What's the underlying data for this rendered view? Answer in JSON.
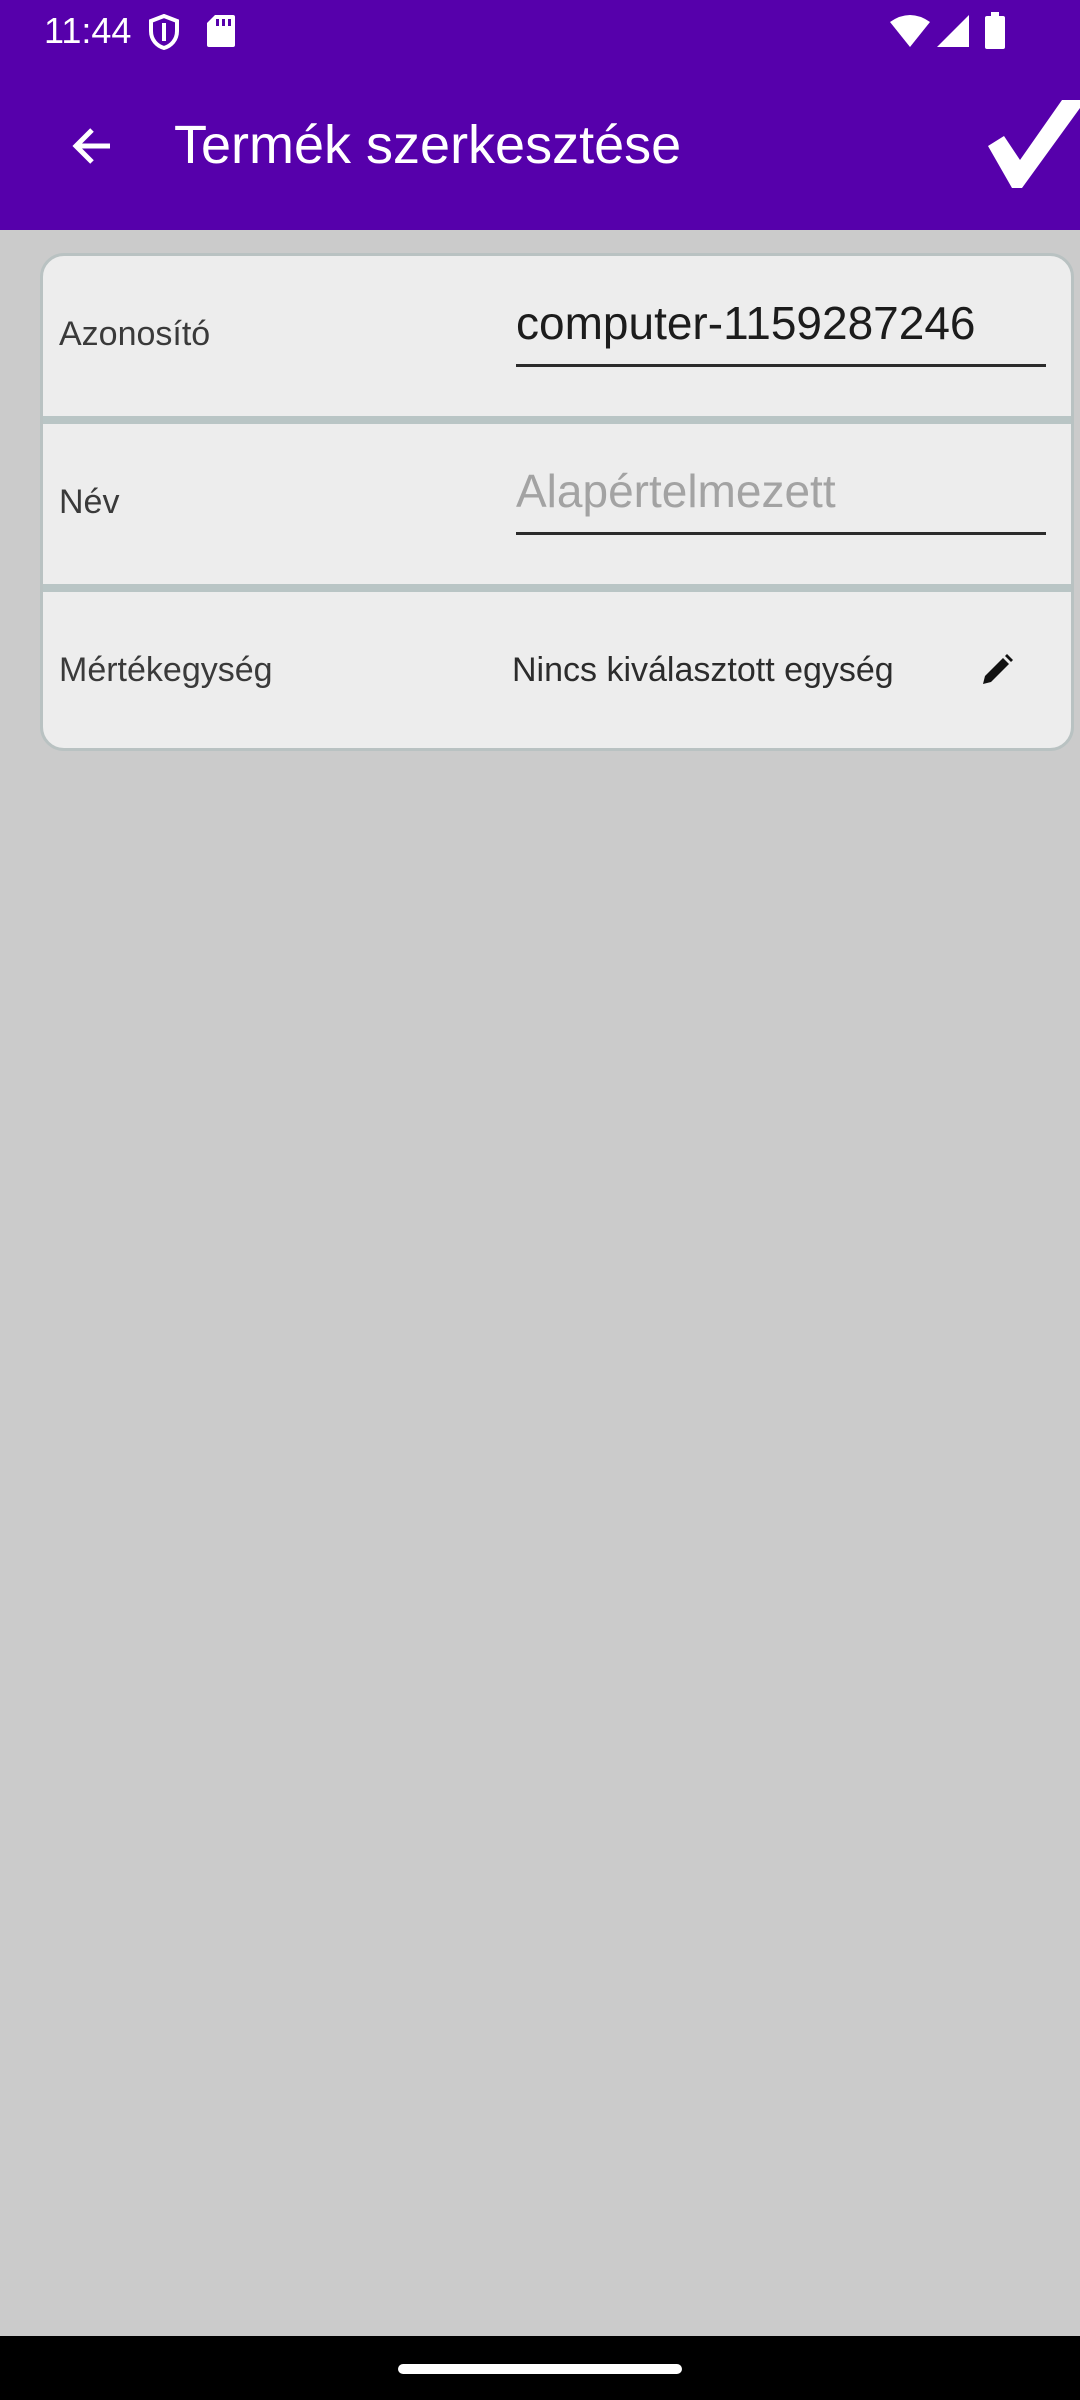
{
  "status_bar": {
    "time": "11:44",
    "icons": [
      "shield-icon",
      "sd-card-icon",
      "wifi-icon",
      "signal-icon",
      "battery-icon"
    ]
  },
  "app_bar": {
    "title": "Termék szerkesztése",
    "back_icon": "arrow-back-icon",
    "save_icon": "checkmark-icon"
  },
  "form": {
    "id_row": {
      "label": "Azonosító",
      "value": "computer-1159287246",
      "placeholder": ""
    },
    "name_row": {
      "label": "Név",
      "value": "",
      "placeholder": "Alapértelmezett"
    },
    "unit_row": {
      "label": "Mértékegység",
      "value": "Nincs kiválasztott egység",
      "edit_icon": "pencil-icon"
    }
  },
  "colors": {
    "primary": "#5600ab",
    "background": "#cbcbcb",
    "card": "#ededed",
    "divider": "#b9c5c5"
  }
}
